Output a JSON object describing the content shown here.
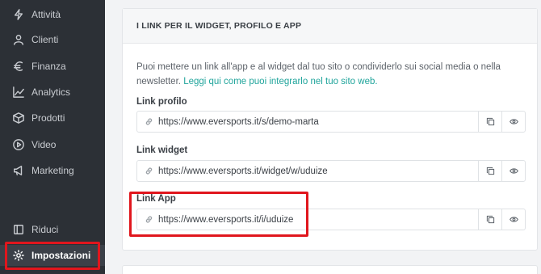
{
  "sidebar": {
    "items": [
      {
        "label": "Attività",
        "icon": "bolt-icon"
      },
      {
        "label": "Clienti",
        "icon": "user-icon"
      },
      {
        "label": "Finanza",
        "icon": "euro-icon"
      },
      {
        "label": "Analytics",
        "icon": "trend-icon"
      },
      {
        "label": "Prodotti",
        "icon": "box-icon"
      },
      {
        "label": "Video",
        "icon": "play-icon"
      },
      {
        "label": "Marketing",
        "icon": "megaphone-icon"
      }
    ],
    "collapse_label": "Riduci",
    "settings_label": "Impostazioni"
  },
  "card": {
    "title": "I LINK PER IL WIDGET, PROFILO E APP",
    "description": "Puoi mettere un link all'app e al widget dal tuo sito o condividerlo sui social media o nella newsletter.",
    "description_link": "Leggi qui come puoi integrarlo nel tuo sito web.",
    "fields": [
      {
        "label": "Link profilo",
        "url": "https://www.eversports.it/s/demo-marta"
      },
      {
        "label": "Link widget",
        "url": "https://www.eversports.it/widget/w/uduize"
      },
      {
        "label": "Link App",
        "url": "https://www.eversports.it/i/uduize"
      }
    ]
  },
  "colors": {
    "sidebar_bg": "#2c3036",
    "accent_link": "#1fa49b",
    "highlight": "#e0161d"
  }
}
